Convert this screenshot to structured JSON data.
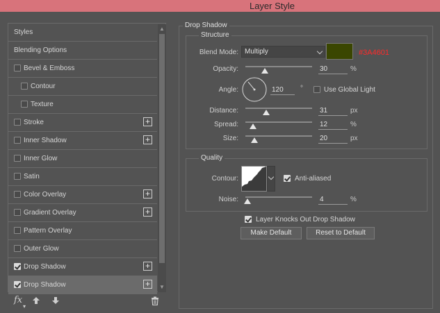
{
  "window": {
    "title": "Layer Style"
  },
  "styles_list": [
    {
      "label": "Styles",
      "checkbox": false,
      "checked": false,
      "plus": false,
      "indent": 0,
      "selected": false
    },
    {
      "label": "Blending Options",
      "checkbox": false,
      "checked": false,
      "plus": false,
      "indent": 0,
      "selected": false
    },
    {
      "label": "Bevel & Emboss",
      "checkbox": true,
      "checked": false,
      "plus": false,
      "indent": 0,
      "selected": false
    },
    {
      "label": "Contour",
      "checkbox": true,
      "checked": false,
      "plus": false,
      "indent": 1,
      "selected": false
    },
    {
      "label": "Texture",
      "checkbox": true,
      "checked": false,
      "plus": false,
      "indent": 1,
      "selected": false
    },
    {
      "label": "Stroke",
      "checkbox": true,
      "checked": false,
      "plus": true,
      "indent": 0,
      "selected": false
    },
    {
      "label": "Inner Shadow",
      "checkbox": true,
      "checked": false,
      "plus": true,
      "indent": 0,
      "selected": false
    },
    {
      "label": "Inner Glow",
      "checkbox": true,
      "checked": false,
      "plus": false,
      "indent": 0,
      "selected": false
    },
    {
      "label": "Satin",
      "checkbox": true,
      "checked": false,
      "plus": false,
      "indent": 0,
      "selected": false
    },
    {
      "label": "Color Overlay",
      "checkbox": true,
      "checked": false,
      "plus": true,
      "indent": 0,
      "selected": false
    },
    {
      "label": "Gradient Overlay",
      "checkbox": true,
      "checked": false,
      "plus": true,
      "indent": 0,
      "selected": false
    },
    {
      "label": "Pattern Overlay",
      "checkbox": true,
      "checked": false,
      "plus": false,
      "indent": 0,
      "selected": false
    },
    {
      "label": "Outer Glow",
      "checkbox": true,
      "checked": false,
      "plus": false,
      "indent": 0,
      "selected": false
    },
    {
      "label": "Drop Shadow",
      "checkbox": true,
      "checked": true,
      "plus": true,
      "indent": 0,
      "selected": false
    },
    {
      "label": "Drop Shadow",
      "checkbox": true,
      "checked": true,
      "plus": true,
      "indent": 0,
      "selected": true
    }
  ],
  "bottom_bar": {
    "fx": "fx",
    "up_icon": "arrow-up-icon",
    "down_icon": "arrow-down-icon",
    "trash_icon": "trash-icon"
  },
  "drop_shadow": {
    "section_title": "Drop Shadow",
    "structure_title": "Structure",
    "blend_mode_label": "Blend Mode:",
    "blend_mode_value": "Multiply",
    "color_swatch": "#3A4601",
    "color_hex_label": "#3A4601",
    "opacity_label": "Opacity:",
    "opacity_value": "30",
    "opacity_unit": "%",
    "angle_label": "Angle:",
    "angle_value": "120",
    "angle_unit": "°",
    "use_global_light_label": "Use Global Light",
    "use_global_light_checked": false,
    "distance_label": "Distance:",
    "distance_value": "31",
    "distance_unit": "px",
    "spread_label": "Spread:",
    "spread_value": "12",
    "spread_unit": "%",
    "size_label": "Size:",
    "size_value": "20",
    "size_unit": "px",
    "quality_title": "Quality",
    "contour_label": "Contour:",
    "anti_aliased_label": "Anti-aliased",
    "anti_aliased_checked": true,
    "noise_label": "Noise:",
    "noise_value": "4",
    "noise_unit": "%",
    "knockout_label": "Layer Knocks Out Drop Shadow",
    "knockout_checked": true,
    "make_default_label": "Make Default",
    "reset_default_label": "Reset to Default"
  },
  "colors": {
    "title_bar": "#d8737b",
    "panel_bg": "#535353",
    "hex_label": "#ff2a2a"
  }
}
